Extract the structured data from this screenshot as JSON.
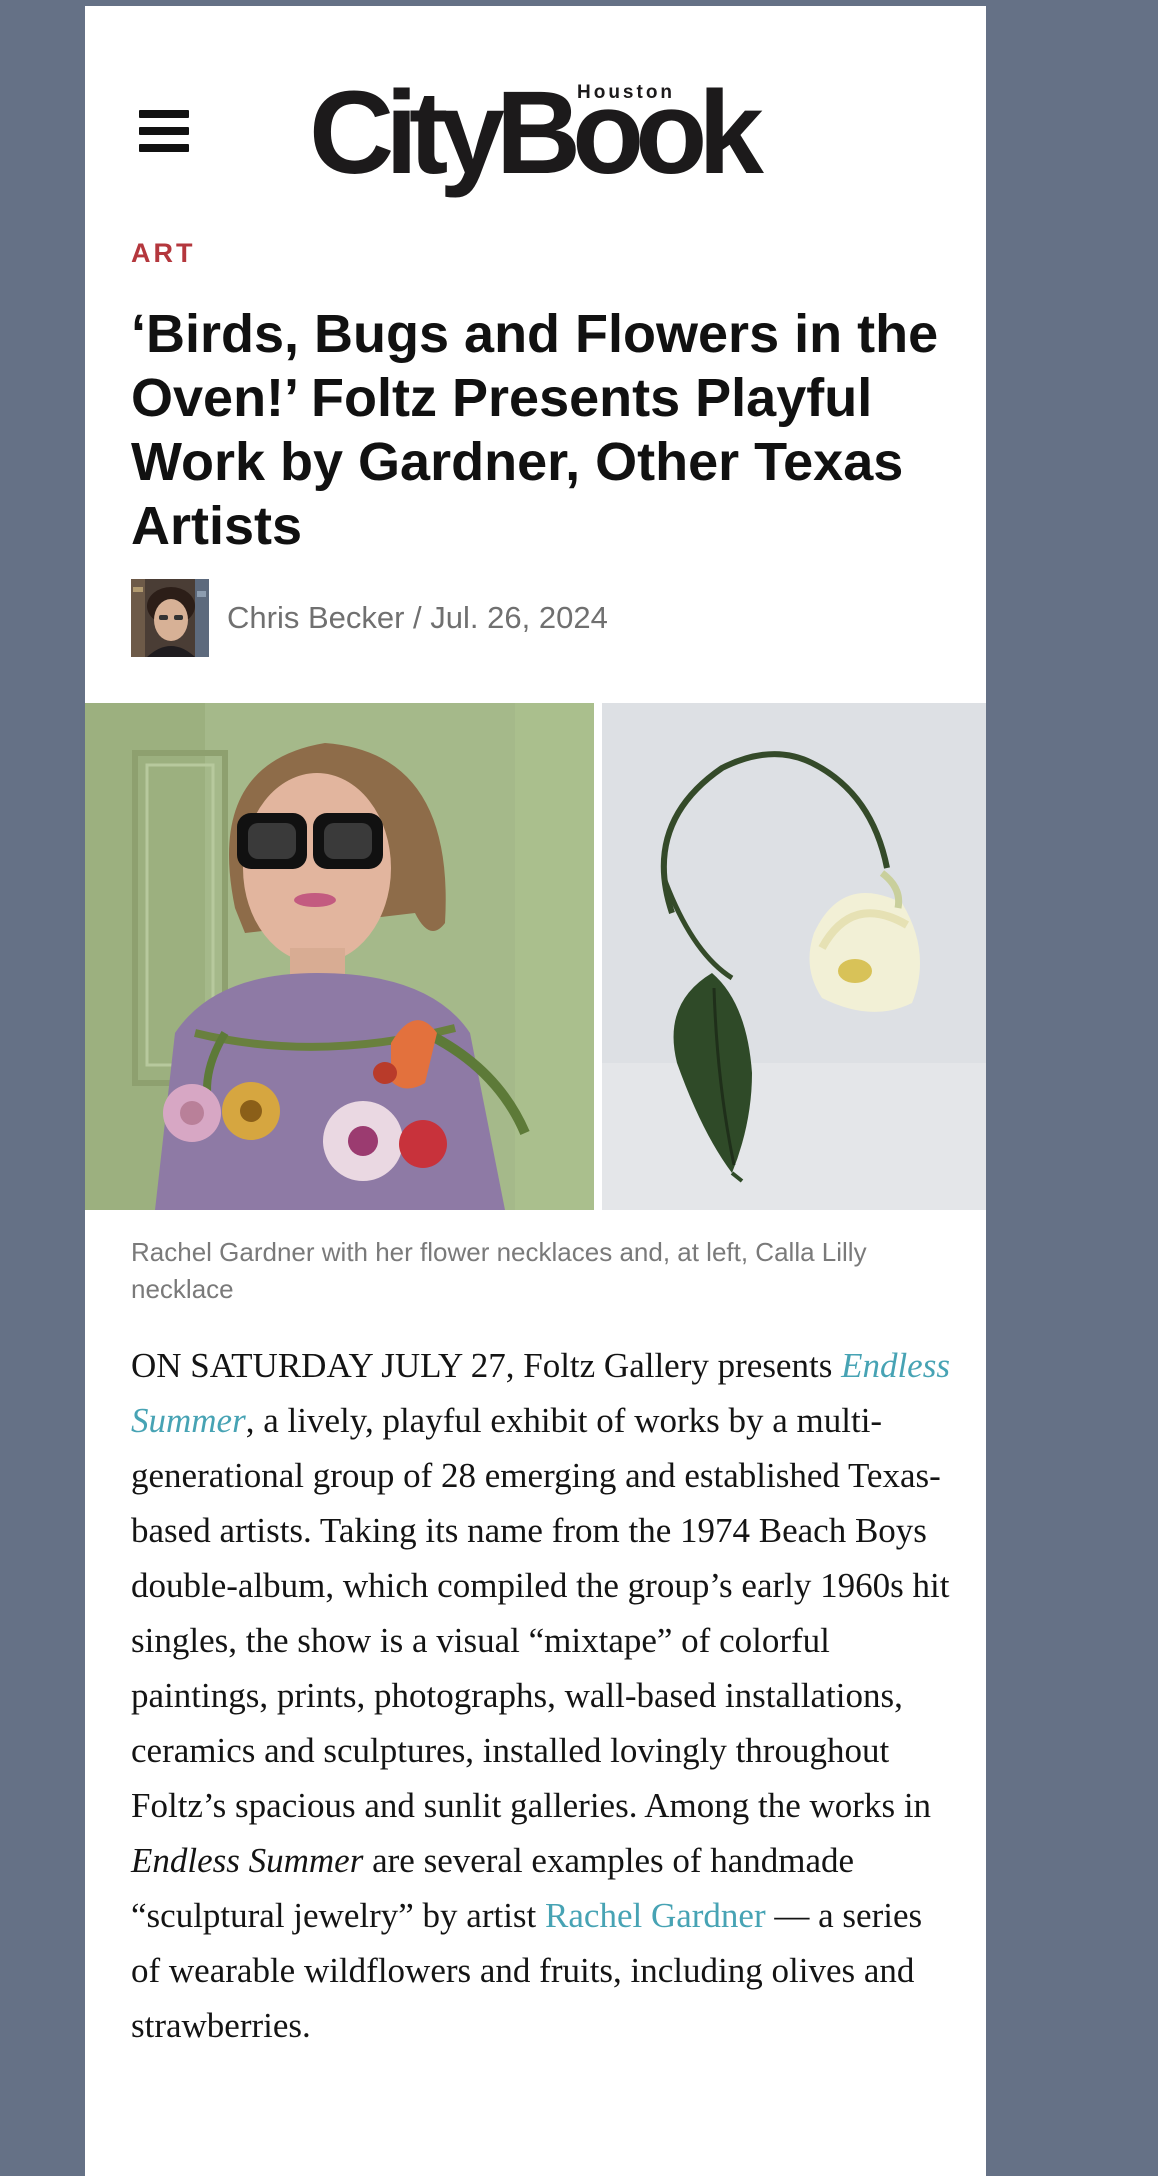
{
  "colors": {
    "background": "#657186",
    "page": "#ffffff",
    "category": "#b4373d",
    "link": "#47a3b4",
    "byline": "#707070",
    "caption": "#7a7a7a"
  },
  "header": {
    "menu_icon": "hamburger-menu-icon",
    "logo": {
      "main": "CityBook",
      "sub": "Houston"
    }
  },
  "article": {
    "category": "ART",
    "title": "‘Birds, Bugs and Flowers in the Oven!’ Foltz Presents Playful Work by Gardner, Other Texas Artists",
    "author": "Chris Becker",
    "separator": " / ",
    "date": "Jul. 26, 2024",
    "caption": "Rachel Gardner with her flower necklaces and, at left, Calla Lilly necklace",
    "body": {
      "lead": "ON SATURDAY JULY 27, Foltz Gallery presents ",
      "exhibit_link": "Endless Summer",
      "text1": ", a lively, playful exhibit of works by a multi-generational group of 28 emerging and established Texas-based artists. Taking its name from the 1974 Beach Boys double-album, which compiled the group’s early 1960s hit singles, the show is a visual “mixtape” of colorful paintings, prints, photographs, wall-based installations, ceramics and sculptures, installed lovingly throughout Foltz’s spacious and sunlit galleries. Among the works in ",
      "exhibit_italic": "Endless Summer",
      "text2": " are several examples of handmade “sculptural jewelry” by artist ",
      "artist_link": "Rachel Gardner",
      "text3": " — a series of wearable wildflowers and fruits, including olives and strawberries."
    }
  }
}
